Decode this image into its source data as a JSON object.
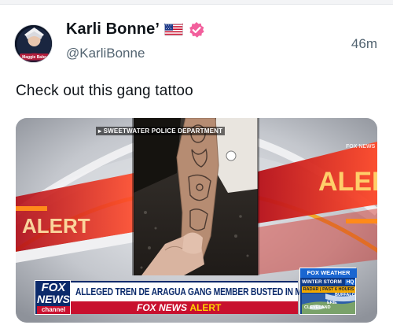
{
  "post": {
    "author": {
      "display_name": "Karli Bonne’",
      "handle": "@KarliBonne",
      "verified": true,
      "avatar_caption": "Maggie Babe",
      "flag_icon": "us-flag-icon",
      "verified_icon": "verified-badge-icon",
      "verified_color": "#f25f9c"
    },
    "timestamp": "46m",
    "text": "Check out this gang tattoo"
  },
  "media": {
    "photo_credit": "▸ SWEETWATER POLICE DEPARTMENT",
    "network_logo": {
      "line1": "FOX",
      "line2": "NEWS",
      "line3": "channel"
    },
    "headline": "ALLEGED TREN DE ARAGUA GANG MEMBER BUSTED IN MIAMI",
    "alert_brand": "FOX NEWS",
    "alert_word": "ALERT",
    "weather": {
      "header": "FOX WEATHER",
      "line1": "WINTER STORM",
      "line1_badge": "HQ",
      "line2": "RADAR | PAST 6 HOURS",
      "city1": "BUFFALO",
      "city2": "CLEVELAND",
      "city3": "ERIE"
    },
    "background_words": [
      "ALERT",
      "ALERT",
      "FOX NEWS"
    ]
  },
  "colors": {
    "fox_blue": "#0b2a6b",
    "fox_red": "#c8102e",
    "alert_yellow": "#ffd400",
    "handle_gray": "#536471"
  }
}
